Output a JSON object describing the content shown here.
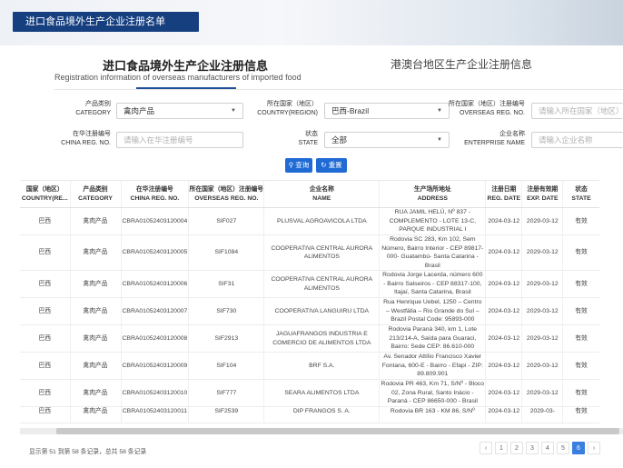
{
  "header": {
    "tab_label": "进口食品境外生产企业注册名单"
  },
  "titles": {
    "main_cn": "进口食品境外生产企业注册信息",
    "main_en": "Registration information of overseas manufacturers of imported food",
    "secondary_cn": "港澳台地区生产企业注册信息"
  },
  "filters": {
    "category": {
      "label_cn": "产品类别",
      "label_en": "CATEGORY",
      "value": "禽肉产品"
    },
    "country": {
      "label_cn": "所在国家（地区）",
      "label_en": "COUNTRY(REGION)",
      "value": "巴西-Brazil"
    },
    "overseas_reg": {
      "label_cn": "所在国家（地区）注册编号",
      "label_en": "OVERSEAS REG. NO.",
      "placeholder": "请输入所在国家（地区）"
    },
    "china_reg": {
      "label_cn": "在华注册编号",
      "label_en": "CHINA REG. NO.",
      "placeholder": "请输入在华注册编号"
    },
    "state": {
      "label_cn": "状态",
      "label_en": "STATE",
      "value": "全部"
    },
    "enterprise": {
      "label_cn": "企业名称",
      "label_en": "ENTERPRISE NAME",
      "placeholder": "请输入企业名称"
    }
  },
  "buttons": {
    "query": "查询",
    "reset": "重置",
    "query_icon": "search-icon",
    "reset_icon": "refresh-icon"
  },
  "table": {
    "headers": [
      {
        "cn": "国家（地区）",
        "en": "COUNTRY(RE..."
      },
      {
        "cn": "产品类别",
        "en": "CATEGORY"
      },
      {
        "cn": "在华注册编号",
        "en": "CHINA REG. NO."
      },
      {
        "cn": "所在国家（地区）注册编号",
        "en": "OVERSEAS REG. NO."
      },
      {
        "cn": "企业名称",
        "en": "NAME"
      },
      {
        "cn": "生产场所地址",
        "en": "ADDRESS"
      },
      {
        "cn": "注册日期",
        "en": "REG. DATE"
      },
      {
        "cn": "注册有效期",
        "en": "EXP. DATE"
      },
      {
        "cn": "状态",
        "en": "STATE"
      }
    ],
    "rows": [
      {
        "country": "巴西",
        "category": "禽肉产品",
        "china_reg": "CBRA01052403120004",
        "overseas_reg": "SIF027",
        "name": "PLUSVAL AGROAVICOLA LTDA",
        "address": "RUA JAMIL HELÚ, Nº 837 - COMPLEMENTO - LOTE 13-C, PARQUE INDUSTRIAL I",
        "reg_date": "2024-03-12",
        "exp_date": "2029-03-12",
        "state": "有效"
      },
      {
        "country": "巴西",
        "category": "禽肉产品",
        "china_reg": "CBRA01052403120005",
        "overseas_reg": "SIF1084",
        "name": "COOPERATIVA CENTRAL AURORA ALIMENTOS",
        "address": "Rodovia SC 283, Km 102, Sem Número, Bairro Interior - CEP 89817-000- Guatambú- Santa Catarina - Brasil",
        "reg_date": "2024-03-12",
        "exp_date": "2029-03-12",
        "state": "有效"
      },
      {
        "country": "巴西",
        "category": "禽肉产品",
        "china_reg": "CBRA01052403120006",
        "overseas_reg": "SIF31",
        "name": "COOPERATIVA CENTRAL AURORA ALIMENTOS",
        "address": "Rodovia Jorge Lacerda, número 600 - Bairro Salseiros - CEP 88317-100, Itajaí, Santa Catarina, Brasil",
        "reg_date": "2024-03-12",
        "exp_date": "2029-03-12",
        "state": "有效"
      },
      {
        "country": "巴西",
        "category": "禽肉产品",
        "china_reg": "CBRA01052403120007",
        "overseas_reg": "SIF730",
        "name": "COOPERATIVA LANGUIRU LTDA",
        "address": "Rua Henrique Uebel, 1250 – Centro – Westfália – Rio Grande do Sul – Brazil Postal Code: 95893-000",
        "reg_date": "2024-03-12",
        "exp_date": "2029-03-12",
        "state": "有效"
      },
      {
        "country": "巴西",
        "category": "禽肉产品",
        "china_reg": "CBRA01052403120008",
        "overseas_reg": "SIF2913",
        "name": "JAGUAFRANGOS INDUSTRIA E COMERCIO DE ALIMENTOS LTDA",
        "address": "Rodovia Paraná 340, km 1, Lote 213/214-A, Saída para Guaraci, Bairro: Sede CEP: 86.610-000",
        "reg_date": "2024-03-12",
        "exp_date": "2029-03-12",
        "state": "有效"
      },
      {
        "country": "巴西",
        "category": "禽肉产品",
        "china_reg": "CBRA01052403120009",
        "overseas_reg": "SIF104",
        "name": "BRF S.A.",
        "address": "Av. Senador Attílio Francisco Xavier Fontana, 600-E - Bairro - Efapi - ZIP: 89.809.901",
        "reg_date": "2024-03-12",
        "exp_date": "2029-03-12",
        "state": "有效"
      },
      {
        "country": "巴西",
        "category": "禽肉产品",
        "china_reg": "CBRA01052403120010",
        "overseas_reg": "SIF777",
        "name": "SEARA ALIMENTOS LTDA",
        "address": "Rodovia PR 463, Km 71, S/Nº - Bloco 02, Zona Rural, Santo Inácio - Paraná - CEP 86650-000 - Brasil",
        "reg_date": "2024-03-12",
        "exp_date": "2029-03-12",
        "state": "有效"
      },
      {
        "country": "巴西",
        "category": "禽肉产品",
        "china_reg": "CBRA01052403120011",
        "overseas_reg": "SIF2539",
        "name": "DIP FRANGOS S. A.",
        "address": "Rodovia BR 163 - KM 86, S/Nº",
        "reg_date": "2024-03-12",
        "exp_date": "2029-03-",
        "state": "有效"
      }
    ]
  },
  "footer": {
    "summary": "显示第 51 到第 58 条记录，总共 58 条记录",
    "pages": [
      "‹",
      "1",
      "2",
      "3",
      "4",
      "5",
      "6",
      "›"
    ],
    "current_page": "6"
  }
}
